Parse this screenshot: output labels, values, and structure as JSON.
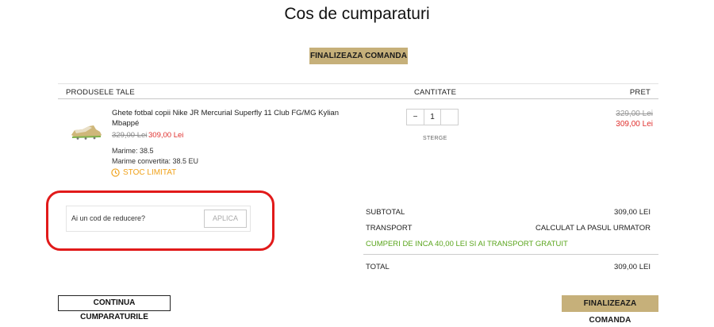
{
  "page": {
    "title": "Cos de cumparaturi"
  },
  "actions": {
    "checkout_top": "FINALIZEAZA COMANDA",
    "checkout_bottom": "FINALIZEAZA COMANDA",
    "continue_shopping": "CONTINUA CUMPARATURILE"
  },
  "table": {
    "headers": {
      "products": "PRODUSELE TALE",
      "quantity": "CANTITATE",
      "price": "PRET"
    }
  },
  "item": {
    "name": "Ghete fotbal copii Nike JR Mercurial Superfly 11 Club FG/MG Kylian Mbappé",
    "old_price": "329,00 Lei",
    "new_price": "309,00 Lei",
    "size": "Marime: 38.5",
    "converted_size": "Marime convertita: 38.5 EU",
    "stock": "STOC LIMITAT",
    "quantity": "1",
    "minus": "−",
    "plus": "",
    "remove": "STERGE",
    "line_old_price": "329,00 Lei",
    "line_new_price": "309,00 Lei"
  },
  "coupon": {
    "label": "Ai un cod de reducere?",
    "apply": "APLICA"
  },
  "summary": {
    "subtotal_label": "SUBTOTAL",
    "subtotal_value": "309,00 LEI",
    "transport_label": "TRANSPORT",
    "transport_value": "CALCULAT LA PASUL URMATOR",
    "free_shipping_msg": "CUMPERI DE INCA 40,00 LEI SI AI TRANSPORT GRATUIT",
    "total_label": "TOTAL",
    "total_value": "309,00 LEI"
  },
  "colors": {
    "accent": "#c6b07a",
    "sale": "#e0302e",
    "stock": "#f0a21b",
    "promo": "#5aa51c",
    "highlight": "#e11a1a"
  },
  "icons": {
    "stock": "clock-icon",
    "product": "football-boot-image"
  }
}
